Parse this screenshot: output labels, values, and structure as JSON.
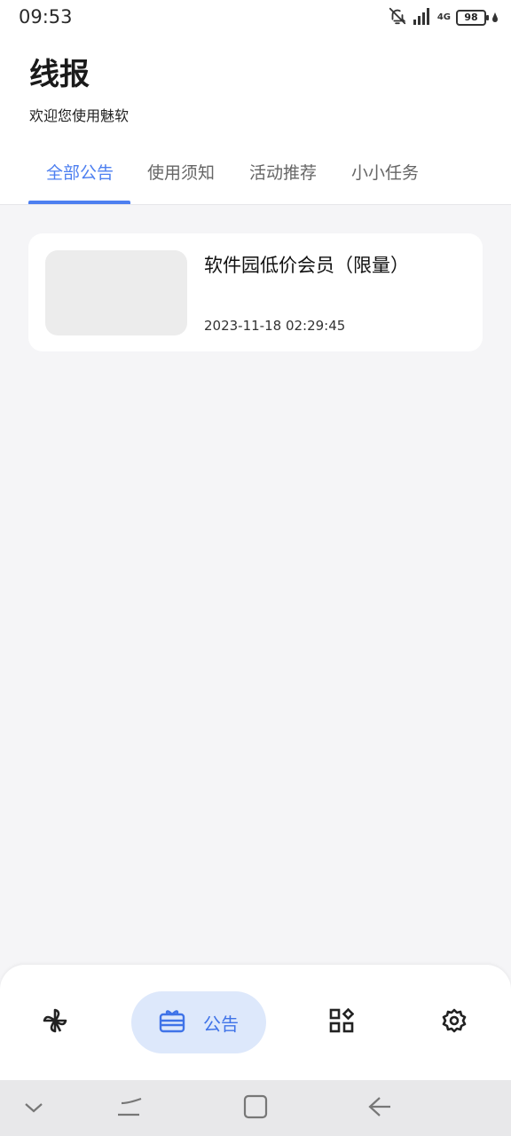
{
  "status_bar": {
    "time": "09:53",
    "battery": "98",
    "network": "4G"
  },
  "header": {
    "title": "线报",
    "subtitle": "欢迎您使用魅软"
  },
  "tabs": [
    {
      "label": "全部公告",
      "active": true
    },
    {
      "label": "使用须知",
      "active": false
    },
    {
      "label": "活动推荐",
      "active": false
    },
    {
      "label": "小小任务",
      "active": false
    }
  ],
  "notices": [
    {
      "title": "软件园低价会员（限量）",
      "date": "2023-11-18 02:29:45"
    }
  ],
  "bottom_nav": {
    "items": [
      {
        "icon": "pinwheel-icon",
        "label": ""
      },
      {
        "icon": "gift-card-icon",
        "label": "公告",
        "active": true
      },
      {
        "icon": "apps-grid-icon",
        "label": ""
      },
      {
        "icon": "gear-icon",
        "label": ""
      }
    ]
  },
  "colors": {
    "accent": "#4d7ff0",
    "pill_bg": "#dde8fb",
    "page_bg": "#f5f5f7"
  }
}
